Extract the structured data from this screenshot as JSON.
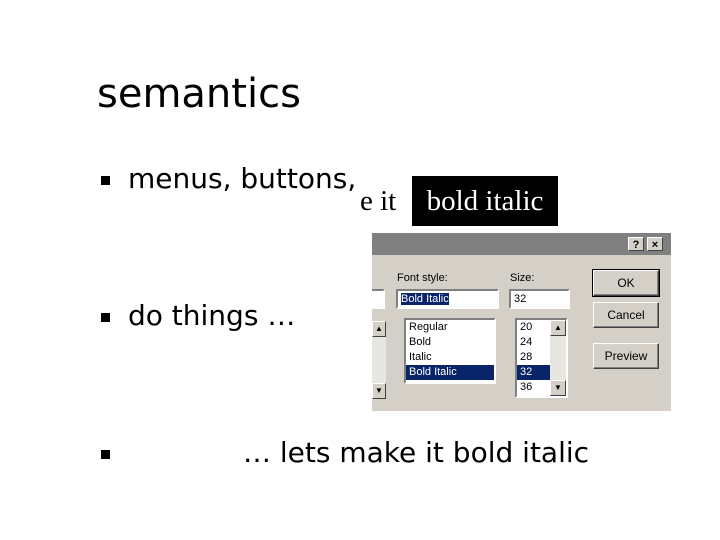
{
  "slide": {
    "title": "semantics",
    "bullets": [
      {
        "text": "menus, buttons,"
      },
      {
        "text": "do things …"
      },
      {
        "text": "… lets make it bold italic"
      }
    ]
  },
  "snippet": {
    "plain_text": "e it",
    "highlighted_text": "bold italic"
  },
  "dialog": {
    "title_buttons": {
      "help": "?",
      "close": "×"
    },
    "font_style": {
      "label": "Font style:",
      "value": "Bold Italic",
      "options": [
        "Regular",
        "Bold",
        "Italic",
        "Bold Italic"
      ],
      "selected": "Bold Italic"
    },
    "size": {
      "label": "Size:",
      "value": "32",
      "options": [
        "20",
        "24",
        "28",
        "32",
        "36"
      ],
      "selected": "32"
    },
    "buttons": {
      "ok": "OK",
      "cancel": "Cancel",
      "preview": "Preview"
    }
  },
  "colors": {
    "dialog_face": "#d4d0c8",
    "selection": "#0a246a",
    "titlebar": "#808080"
  }
}
